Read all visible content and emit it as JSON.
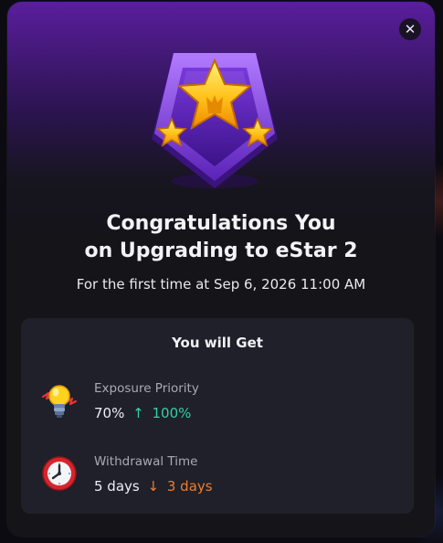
{
  "modal": {
    "close_symbol": "✕",
    "badge_icon": "estar-badge-icon",
    "title_line1": "Congratulations You",
    "title_line2": "on Upgrading to eStar 2",
    "subtitle": "For the first time at Sep 6, 2026 11:00 AM"
  },
  "benefits": {
    "title": "You will Get",
    "items": [
      {
        "icon": "lightbulb-icon",
        "label": "Exposure Priority",
        "from": "70%",
        "arrow": "↑",
        "to": "100%"
      },
      {
        "icon": "clock-icon",
        "label": "Withdrawal Time",
        "from": "5 days",
        "arrow": "↓",
        "to": "3 days"
      }
    ]
  },
  "colors": {
    "modal_top": "#5a1e9e",
    "modal_bottom": "#141419",
    "panel": "#1f2029",
    "increase": "#34d1a5",
    "decrease": "#f07c2b"
  }
}
